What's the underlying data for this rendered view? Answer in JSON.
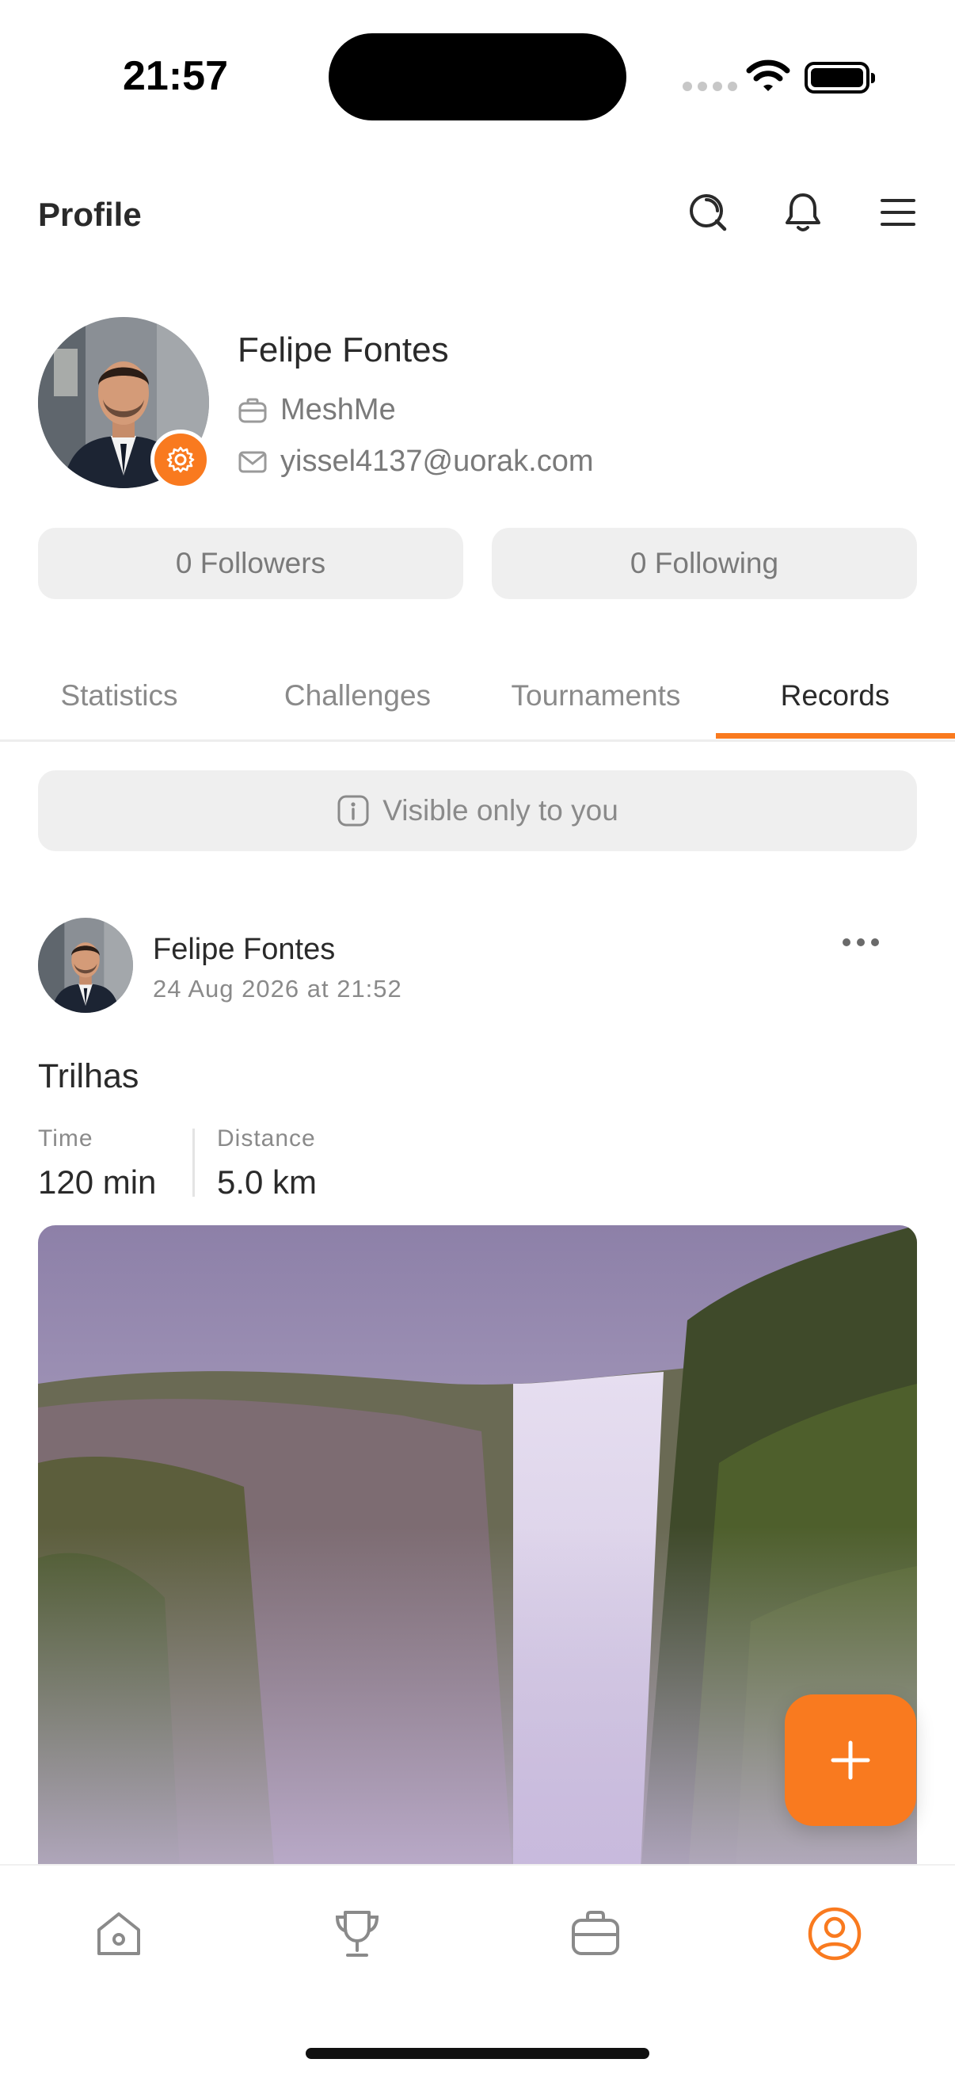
{
  "status_bar": {
    "time": "21:57"
  },
  "header": {
    "title": "Profile"
  },
  "profile": {
    "name": "Felipe Fontes",
    "company": "MeshMe",
    "email": "yissel4137@uorak.com",
    "followers_label": "0 Followers",
    "following_label": "0 Following"
  },
  "tabs": [
    {
      "label": "Statistics"
    },
    {
      "label": "Challenges"
    },
    {
      "label": "Tournaments"
    },
    {
      "label": "Records",
      "active": true
    }
  ],
  "notice": {
    "text": "Visible only to you"
  },
  "post": {
    "author": "Felipe Fontes",
    "date": "24 Aug 2026 at 21:52",
    "title": "Trilhas",
    "stats": [
      {
        "label": "Time",
        "value": "120 min"
      },
      {
        "label": "Distance",
        "value": "5.0 km"
      }
    ]
  },
  "bottom_nav": [
    {
      "icon": "home-icon"
    },
    {
      "icon": "trophy-icon"
    },
    {
      "icon": "briefcase-icon"
    },
    {
      "icon": "profile-icon",
      "active": true
    }
  ],
  "colors": {
    "accent": "#f97a1f",
    "pill_bg": "#efefef",
    "text": "#2a2a2a",
    "muted": "#8a8a8a"
  }
}
